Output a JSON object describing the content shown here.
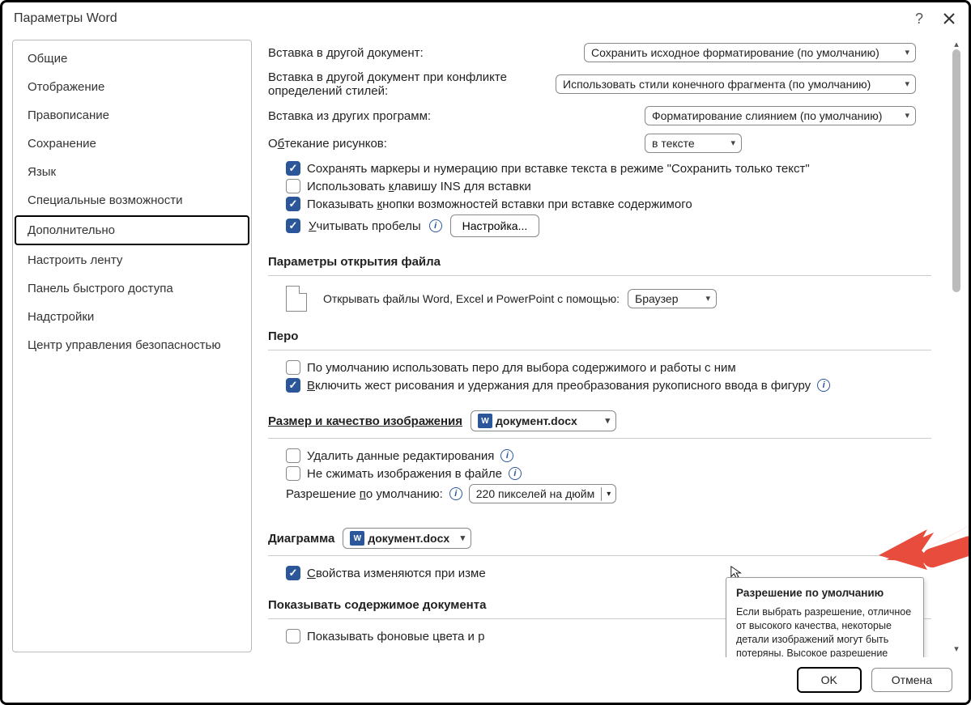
{
  "title": "Параметры Word",
  "sidebar": {
    "items": [
      {
        "label": "Общие"
      },
      {
        "label": "Отображение"
      },
      {
        "label": "Правописание"
      },
      {
        "label": "Сохранение"
      },
      {
        "label": "Язык"
      },
      {
        "label": "Специальные возможности"
      },
      {
        "label": "Дополнительно"
      },
      {
        "label": "Настроить ленту"
      },
      {
        "label": "Панель быстрого доступа"
      },
      {
        "label": "Надстройки"
      },
      {
        "label": "Центр управления безопасностью"
      }
    ],
    "selected_index": 6
  },
  "paste": {
    "other_doc_label": "Вставка в другой документ:",
    "other_doc_value": "Сохранить исходное форматирование (по умолчанию)",
    "conflict_label": "Вставка в другой документ при конфликте определений стилей:",
    "conflict_value": "Использовать стили конечного фрагмента (по умолчанию)",
    "other_prog_label": "Вставка из других программ:",
    "other_prog_value": "Форматирование слиянием (по умолчанию)",
    "wrap_label": "Обтекание рисунков:",
    "wrap_value": "в тексте",
    "keep_bullets": "Сохранять маркеры и нумерацию при вставке текста в режиме \"Сохранить только текст\"",
    "ins_key": "Использовать клавишу INS для вставки",
    "show_paste_btn": "Показывать кнопки возможностей вставки при вставке содержимого",
    "smart_cut": "Учитывать пробелы",
    "settings_btn": "Настройка..."
  },
  "file_open": {
    "section": "Параметры открытия файла",
    "open_with_label": "Открывать файлы Word, Excel и PowerPoint с помощью:",
    "open_with_value": "Браузер"
  },
  "pen": {
    "section": "Перо",
    "default_pen": "По умолчанию использовать перо для выбора содержимого и работы с ним",
    "ink_gesture": "Включить жест рисования и удержания для преобразования рукописного ввода в фигуру"
  },
  "image_quality": {
    "section": "Размер и качество изображения",
    "doc_value": "документ.docx",
    "discard_edit": "Удалить данные редактирования",
    "no_compress": "Не сжимать изображения в файле",
    "default_res_label": "Разрешение по умолчанию:",
    "default_res_value": "220 пикселей на дюйм"
  },
  "chart": {
    "section": "Диаграмма",
    "doc_value": "документ.docx",
    "props_follow": "Свойства изменяются при изме"
  },
  "show_content": {
    "section": "Показывать содержимое документа",
    "bg_colors": "Показывать фоновые цвета и р"
  },
  "tooltip": {
    "title": "Разрешение по умолчанию",
    "body": "Если выбрать разрешение, отличное от высокого качества, некоторые детали изображений могут быть потеряны. Высокое разрешение сохраняет качество изображения, но может увеличить размер документов."
  },
  "footer": {
    "ok": "OK",
    "cancel": "Отмена"
  }
}
